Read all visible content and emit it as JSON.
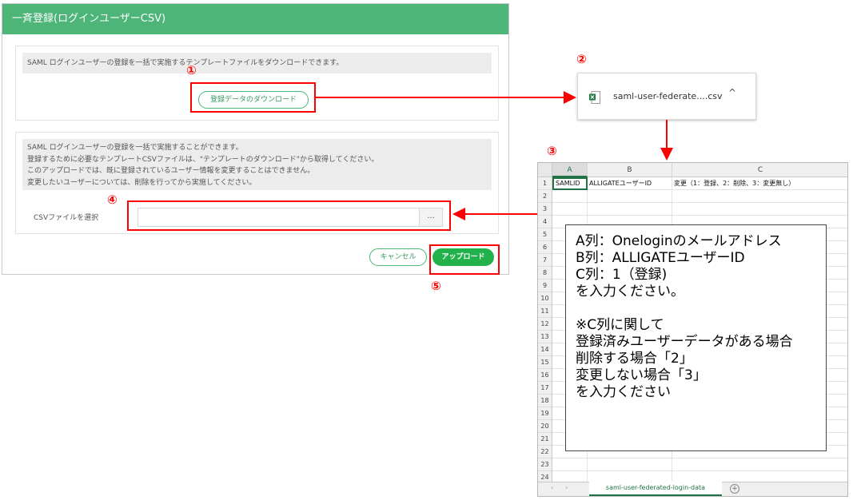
{
  "dialog": {
    "title": "一斉登録(ログインユーザーCSV)",
    "panel1_note": "SAML ログインユーザーの登録を一括で実施するテンプレートファイルをダウンロードできます。",
    "download_button": "登録データのダウンロード",
    "panel2_note": [
      "SAML ログインユーザーの登録を一括で実施することができます。",
      "登録するために必要なテンプレートCSVファイルは、\"テンプレートのダウンロード\"から取得してください。",
      "このアップロードでは、既に登録されているユーザー情報を変更することはできません。",
      "変更したいユーザーについては、削除を行ってから実施してください。"
    ],
    "csv_label": "CSVファイルを選択",
    "csv_value": "",
    "browse_label": "...",
    "cancel_button": "キャンセル",
    "upload_button": "アップロード"
  },
  "markers": [
    "①",
    "②",
    "③",
    "④",
    "⑤"
  ],
  "download_bar": {
    "file_name": "saml-user-federate....csv",
    "icon": "excel-file-icon",
    "chevron": "^"
  },
  "spreadsheet": {
    "columns": [
      "A",
      "B",
      "C"
    ],
    "rows": [
      "1",
      "2",
      "3",
      "4",
      "5",
      "6",
      "7",
      "8",
      "9",
      "10",
      "11",
      "12",
      "13",
      "14",
      "15",
      "16",
      "17",
      "18",
      "19",
      "20",
      "21",
      "22",
      "23",
      "24"
    ],
    "row1": [
      "SAMLID",
      "ALLIGATEユーザーID",
      "変更（1：登録、2：削除、3：変更無し）"
    ],
    "sheet_tab": "saml-user-federated-login-data",
    "nav_prev": "‹",
    "nav_next": "›",
    "add_sheet": "+"
  },
  "instructions": [
    "A列：Oneloginのメールアドレス",
    "B列：ALLIGATEユーザーID",
    "C列：1（登録)",
    "を入力ください。",
    "",
    "※C列に関して",
    "登録済みユーザーデータがある場合",
    "削除する場合「2」",
    "変更しない場合「3」",
    "を入力ください"
  ],
  "colors": {
    "header_green": "#4cb577",
    "upload_green": "#22b24c",
    "highlight_red": "#ff0000",
    "excel_green": "#217346"
  }
}
